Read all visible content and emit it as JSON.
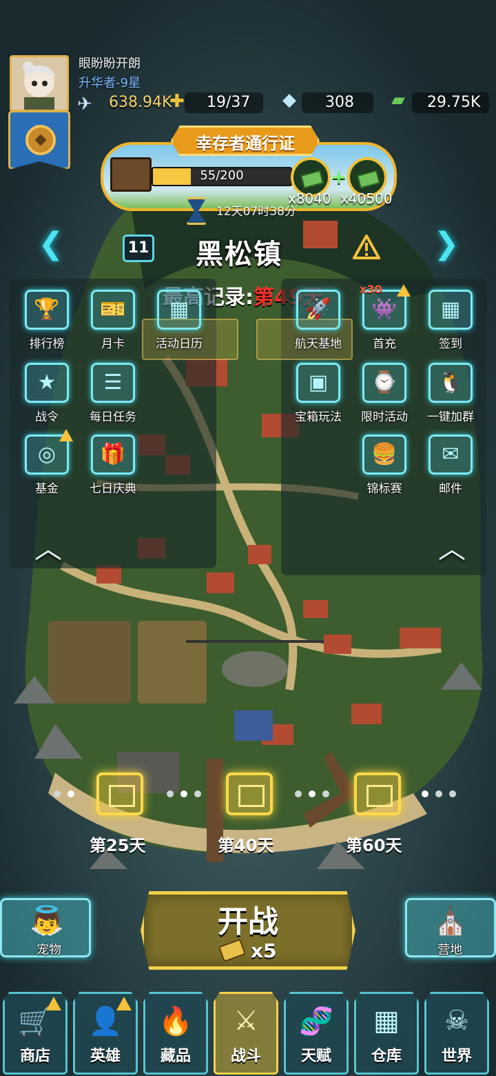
{
  "player": {
    "name": "眼盼盼开朗",
    "rank": "升华者-9星",
    "power": "638.94K"
  },
  "resources": {
    "energy": "19/37",
    "diamonds": "308",
    "cash": "29.75K"
  },
  "pass": {
    "title": "幸存者通行证",
    "progress_text": "55/200",
    "progress_fraction": 0.275,
    "reward_free": "x8040",
    "reward_premium": "x40500",
    "timer": "12天07时38分"
  },
  "location": {
    "level": "11",
    "name": "黑松镇",
    "record_label": "最高记录:",
    "record_value": "第49天"
  },
  "left_features": [
    {
      "label": "排行榜",
      "icon": "trophy-icon",
      "glyph": "🏆"
    },
    {
      "label": "月卡",
      "icon": "ticket-icon",
      "glyph": "🎫"
    },
    {
      "label": "活动日历",
      "icon": "calendar-icon",
      "glyph": "▦"
    },
    {
      "label": "战令",
      "icon": "banner-icon",
      "glyph": "★"
    },
    {
      "label": "每日任务",
      "icon": "task-list-icon",
      "glyph": "☰"
    },
    {
      "label": "基金",
      "icon": "safe-icon",
      "glyph": "◎"
    },
    {
      "label": "七日庆典",
      "icon": "gift-icon",
      "glyph": "🎁"
    }
  ],
  "right_features": [
    {
      "label": "航天基地",
      "icon": "rocket-icon",
      "glyph": "🚀"
    },
    {
      "label": "首充",
      "icon": "first-charge-icon",
      "glyph": "👾",
      "count": "x30"
    },
    {
      "label": "签到",
      "icon": "calendar-icon",
      "glyph": "▦"
    },
    {
      "label": "宝箱玩法",
      "icon": "chest-icon",
      "glyph": "▣"
    },
    {
      "label": "限时活动",
      "icon": "limited-event-icon",
      "glyph": "⌚"
    },
    {
      "label": "一键加群",
      "icon": "penguin-icon",
      "glyph": "🐧"
    },
    {
      "label": "锦标赛",
      "icon": "burger-icon",
      "glyph": "🍔"
    },
    {
      "label": "邮件",
      "icon": "mail-icon",
      "glyph": "✉"
    }
  ],
  "milestones": [
    {
      "label": "第25天"
    },
    {
      "label": "第40天"
    },
    {
      "label": "第60天"
    }
  ],
  "actions": {
    "pet": "宠物",
    "battle": "开战",
    "battle_cost": "x5",
    "camp": "营地"
  },
  "nav": [
    {
      "label": "商店",
      "icon": "cart-icon",
      "glyph": "🛒",
      "warn": true
    },
    {
      "label": "英雄",
      "icon": "hero-icon",
      "glyph": "👤",
      "warn": true
    },
    {
      "label": "藏品",
      "icon": "flame-icon",
      "glyph": "🔥",
      "warn": false
    },
    {
      "label": "战斗",
      "icon": "rifle-icon",
      "glyph": "⚔",
      "warn": false,
      "active": true
    },
    {
      "label": "天赋",
      "icon": "dna-icon",
      "glyph": "🧬",
      "warn": false
    },
    {
      "label": "仓库",
      "icon": "crate-icon",
      "glyph": "▦",
      "warn": false
    },
    {
      "label": "世界",
      "icon": "world-icon",
      "glyph": "☠",
      "warn": false
    }
  ],
  "colors": {
    "accent_cyan": "#4de3f0",
    "accent_gold": "#f0cf4a",
    "record_red": "#f5312a",
    "rank_blue": "#7ab8ff"
  }
}
